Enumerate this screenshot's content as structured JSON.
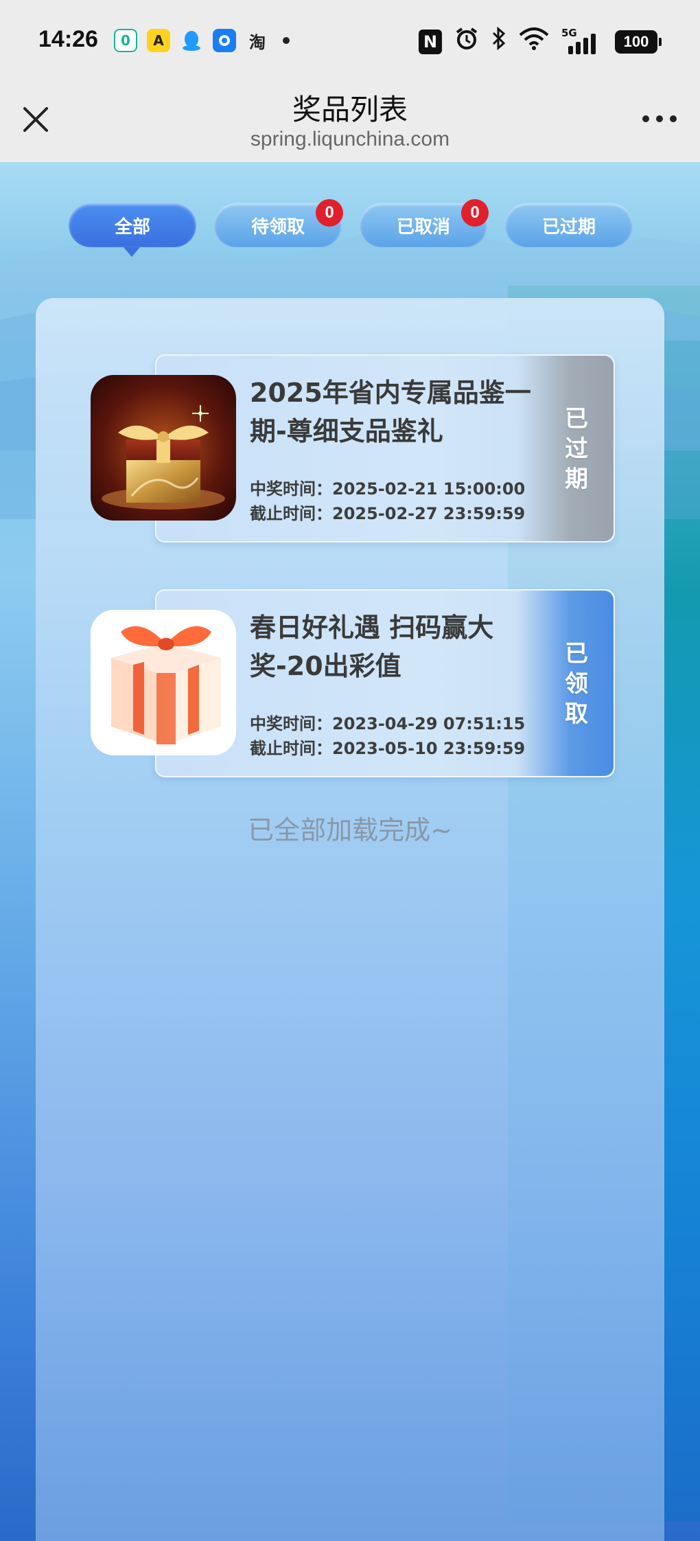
{
  "status_bar": {
    "time": "14:26",
    "apps": [
      "0",
      "A",
      "",
      "",
      "淘"
    ],
    "network": "5G",
    "battery": "100"
  },
  "title_bar": {
    "title": "奖品列表",
    "url": "spring.liqunchina.com"
  },
  "tabs": [
    {
      "label": "全部",
      "active": true
    },
    {
      "label": "待领取",
      "badge": "0"
    },
    {
      "label": "已取消",
      "badge": "0"
    },
    {
      "label": "已过期"
    }
  ],
  "prizes": [
    {
      "title": "2025年省内专属品鉴一期-尊细支品鉴礼",
      "win_time": "中奖时间：2025-02-21 15:00:00",
      "deadline": "截止时间：2025-02-27 23:59:59",
      "status": "已过期",
      "status_color": "#9aa3ad"
    },
    {
      "title": "春日好礼遇 扫码赢大奖-20出彩值",
      "win_time": "中奖时间：2023-04-29 07:51:15",
      "deadline": "截止时间：2023-05-10 23:59:59",
      "status": "已领取",
      "status_color": "#4a8ce2"
    }
  ],
  "footer": {
    "load_done": "已全部加载完成~"
  }
}
